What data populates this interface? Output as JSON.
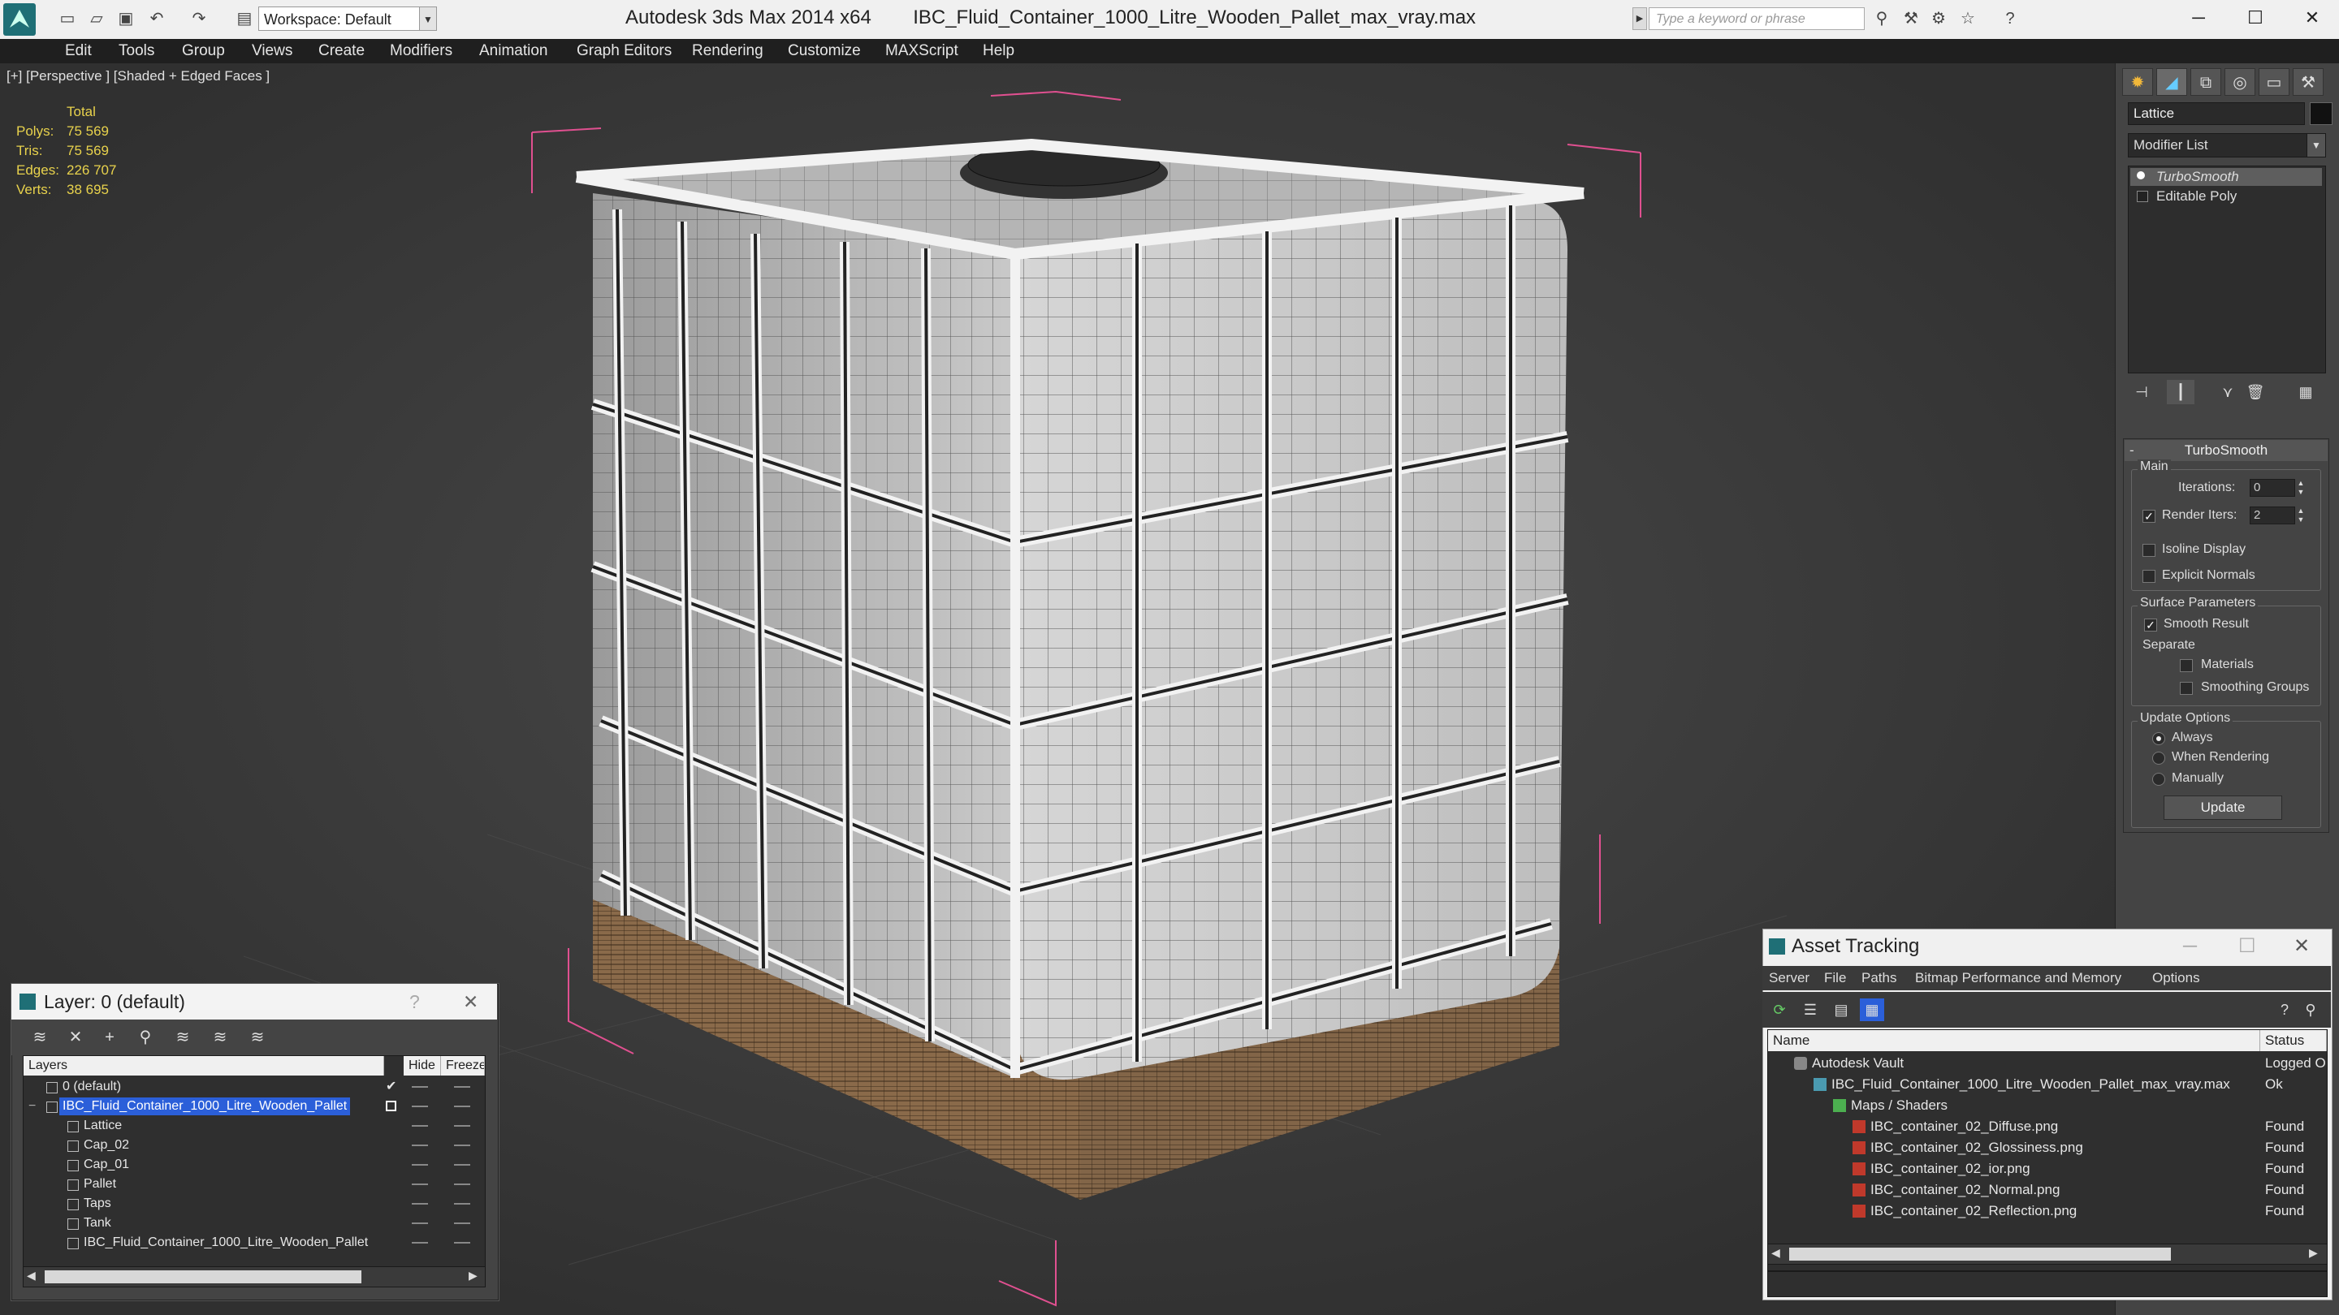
{
  "titlebar": {
    "workspace_label": "Workspace: Default",
    "app_name": "Autodesk 3ds Max  2014 x64",
    "file_name": "IBC_Fluid_Container_1000_Litre_Wooden_Pallet_max_vray.max",
    "search_placeholder": "Type a keyword or phrase"
  },
  "menu": [
    "Edit",
    "Tools",
    "Group",
    "Views",
    "Create",
    "Modifiers",
    "Animation",
    "Graph Editors",
    "Rendering",
    "Customize",
    "MAXScript",
    "Help"
  ],
  "viewport": {
    "label": "[+] [Perspective ] [Shaded + Edged Faces ]",
    "stats": {
      "header": "Total",
      "rows": [
        {
          "label": "Polys:",
          "value": "75 569"
        },
        {
          "label": "Tris:",
          "value": "75 569"
        },
        {
          "label": "Edges:",
          "value": "226 707"
        },
        {
          "label": "Verts:",
          "value": "38 695"
        }
      ]
    }
  },
  "command_panel": {
    "object_name": "Lattice",
    "modifier_list": "Modifier List",
    "stack": [
      "TurboSmooth",
      "Editable Poly"
    ],
    "rollout": {
      "title": "TurboSmooth",
      "main_group": "Main",
      "iterations_label": "Iterations:",
      "iterations_value": "0",
      "render_iters_label": "Render Iters:",
      "render_iters_value": "2",
      "isoline_label": "Isoline Display",
      "explicit_normals_label": "Explicit Normals",
      "surface_group": "Surface Parameters",
      "smooth_result_label": "Smooth Result",
      "separate_label": "Separate",
      "materials_label": "Materials",
      "smoothing_groups_label": "Smoothing Groups",
      "update_group": "Update Options",
      "always_label": "Always",
      "when_rendering_label": "When Rendering",
      "manually_label": "Manually",
      "update_button": "Update"
    }
  },
  "layer_window": {
    "title": "Layer: 0 (default)",
    "close": "✕",
    "help": "?",
    "columns": [
      "Layers",
      "Hide",
      "Freeze"
    ],
    "rows": [
      {
        "name": "0 (default)",
        "indent": 0
      },
      {
        "name": "IBC_Fluid_Container_1000_Litre_Wooden_Pallet",
        "indent": 0
      },
      {
        "name": "Lattice",
        "indent": 1
      },
      {
        "name": "Cap_02",
        "indent": 1
      },
      {
        "name": "Cap_01",
        "indent": 1
      },
      {
        "name": "Pallet",
        "indent": 1
      },
      {
        "name": "Taps",
        "indent": 1
      },
      {
        "name": "Tank",
        "indent": 1
      },
      {
        "name": "IBC_Fluid_Container_1000_Litre_Wooden_Pallet",
        "indent": 1
      }
    ]
  },
  "asset_window": {
    "title": "Asset Tracking",
    "menu": [
      "Server",
      "File",
      "Paths",
      "Bitmap Performance and Memory",
      "Options"
    ],
    "columns": [
      "Name",
      "Status"
    ],
    "rows": [
      {
        "name": "Autodesk Vault",
        "status": "Logged O",
        "indent": 0
      },
      {
        "name": "IBC_Fluid_Container_1000_Litre_Wooden_Pallet_max_vray.max",
        "status": "Ok",
        "indent": 1
      },
      {
        "name": "Maps / Shaders",
        "status": "",
        "indent": 2
      },
      {
        "name": "IBC_container_02_Diffuse.png",
        "status": "Found",
        "indent": 3
      },
      {
        "name": "IBC_container_02_Glossiness.png",
        "status": "Found",
        "indent": 3
      },
      {
        "name": "IBC_container_02_ior.png",
        "status": "Found",
        "indent": 3
      },
      {
        "name": "IBC_container_02_Normal.png",
        "status": "Found",
        "indent": 3
      },
      {
        "name": "IBC_container_02_Reflection.png",
        "status": "Found",
        "indent": 3
      }
    ]
  },
  "colors": {
    "viewport_bg": "#3c3c3c",
    "stats_yellow": "#e8d24c",
    "selection_blue": "#2b5fd9",
    "bbox_pink": "#e05090"
  }
}
